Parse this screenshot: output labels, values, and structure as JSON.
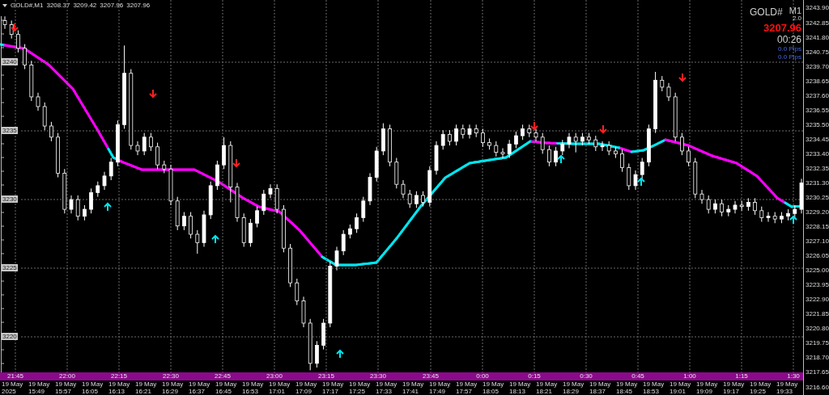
{
  "symbol_bar": {
    "title": "GOLD#,M1",
    "values": [
      "3208.37",
      "3209.42",
      "3207.96",
      "3207.96"
    ]
  },
  "info_panel": {
    "symbol": "GOLD#",
    "timeframe": "M1",
    "version": "2.0",
    "price": "3207.96",
    "countdown": "00:26",
    "pips": [
      "0.0 Pips",
      "0.0 Pips"
    ]
  },
  "level_labels": [
    "3240",
    "3235",
    "3230",
    "3225",
    "3220"
  ],
  "chart": {
    "chart_data": {
      "type": "candlestick",
      "ylim": [
        3216.02,
        3244.48
      ],
      "grid": true,
      "yticks": [
        {
          "value": 3243.9,
          "label": "3243.90"
        },
        {
          "value": 3242.85,
          "label": "3242.85"
        },
        {
          "value": 3241.8,
          "label": "3241.80"
        },
        {
          "value": 3240.75,
          "label": "3240.75"
        },
        {
          "value": 3239.7,
          "label": "3239.70"
        },
        {
          "value": 3238.65,
          "label": "3238.65"
        },
        {
          "value": 3237.6,
          "label": "3237.60"
        },
        {
          "value": 3236.55,
          "label": "3236.55"
        },
        {
          "value": 3235.5,
          "label": "3235.50"
        },
        {
          "value": 3234.45,
          "label": "3234.45"
        },
        {
          "value": 3233.4,
          "label": "3233.40"
        },
        {
          "value": 3232.35,
          "label": "3232.35"
        },
        {
          "value": 3231.3,
          "label": "3231.30"
        },
        {
          "value": 3230.25,
          "label": "3230.25"
        },
        {
          "value": 3229.2,
          "label": "3229.20"
        },
        {
          "value": 3228.15,
          "label": "3228.15"
        },
        {
          "value": 3227.1,
          "label": "3227.10"
        },
        {
          "value": 3226.05,
          "label": "3226.05"
        },
        {
          "value": 3225.0,
          "label": "3225.00"
        },
        {
          "value": 3223.95,
          "label": "3223.95"
        },
        {
          "value": 3222.9,
          "label": "3222.90"
        },
        {
          "value": 3221.85,
          "label": "3221.85"
        },
        {
          "value": 3220.8,
          "label": "3220.80"
        },
        {
          "value": 3219.75,
          "label": "3219.75"
        },
        {
          "value": 3218.7,
          "label": "3218.70"
        },
        {
          "value": 3217.65,
          "label": "3217.65"
        },
        {
          "value": 3216.6,
          "label": "3216.60"
        }
      ],
      "categories": [
        null,
        null,
        null,
        null,
        null,
        null,
        null,
        null,
        null,
        null,
        null,
        null,
        null,
        null,
        null,
        null,
        null,
        null,
        null,
        null,
        null,
        null,
        null,
        null,
        null,
        null,
        null,
        null,
        null,
        null,
        null,
        null,
        null,
        null,
        null,
        null,
        null,
        null,
        null,
        null,
        null,
        null,
        null,
        null,
        null,
        null,
        null,
        null,
        null,
        null,
        null,
        null,
        null,
        null,
        null,
        null,
        null,
        null,
        null,
        null,
        null,
        null,
        null,
        null,
        null,
        null,
        null,
        null,
        null,
        null,
        null,
        null,
        null,
        null,
        null,
        null,
        null,
        null,
        null,
        null,
        null,
        null,
        null,
        null,
        null,
        null,
        null,
        null,
        null,
        null,
        null,
        null,
        null,
        null,
        null,
        null,
        null,
        null,
        null,
        null,
        null,
        null,
        null,
        null,
        null,
        null,
        null,
        null,
        null,
        null,
        null,
        null,
        null,
        null,
        null,
        null,
        null,
        null,
        null,
        null,
        null
      ],
      "ohlc": [
        [
          3243.0,
          3243.3,
          3242.4,
          3242.7
        ],
        [
          3242.7,
          3243.0,
          3241.7,
          3242.0
        ],
        [
          3242.0,
          3242.3,
          3240.7,
          3241.0
        ],
        [
          3241.0,
          3241.3,
          3239.5,
          3239.8
        ],
        [
          3239.8,
          3240.1,
          3237.2,
          3237.5
        ],
        [
          3237.5,
          3237.8,
          3236.5,
          3236.8
        ],
        [
          3236.8,
          3237.1,
          3235.1,
          3235.4
        ],
        [
          3235.4,
          3235.7,
          3234.3,
          3234.6
        ],
        [
          3234.6,
          3234.9,
          3231.7,
          3232.0
        ],
        [
          3232.0,
          3232.3,
          3229.1,
          3229.4
        ],
        [
          3229.4,
          3230.4,
          3229.1,
          3230.1
        ],
        [
          3230.1,
          3230.4,
          3228.6,
          3228.9
        ],
        [
          3228.9,
          3229.7,
          3228.6,
          3229.4
        ],
        [
          3229.4,
          3230.9,
          3229.1,
          3230.6
        ],
        [
          3230.6,
          3231.4,
          3230.3,
          3231.1
        ],
        [
          3231.1,
          3232.1,
          3230.8,
          3231.8
        ],
        [
          3231.8,
          3233.1,
          3231.5,
          3232.8
        ],
        [
          3232.8,
          3235.8,
          3232.5,
          3235.5
        ],
        [
          3235.5,
          3241.2,
          3235.2,
          3239.2
        ],
        [
          3239.2,
          3239.5,
          3233.7,
          3234.0
        ],
        [
          3234.0,
          3234.3,
          3233.3,
          3233.6
        ],
        [
          3233.6,
          3234.9,
          3233.3,
          3234.6
        ],
        [
          3234.6,
          3234.9,
          3233.6,
          3233.9
        ],
        [
          3233.9,
          3234.2,
          3232.3,
          3232.6
        ],
        [
          3232.6,
          3232.9,
          3232.0,
          3232.3
        ],
        [
          3232.3,
          3232.6,
          3229.7,
          3230.0
        ],
        [
          3230.0,
          3230.3,
          3227.9,
          3228.2
        ],
        [
          3228.2,
          3229.2,
          3227.9,
          3228.9
        ],
        [
          3228.9,
          3229.2,
          3227.3,
          3227.6
        ],
        [
          3227.6,
          3227.9,
          3226.2,
          3227.0
        ],
        [
          3227.0,
          3229.3,
          3226.7,
          3229.0
        ],
        [
          3229.0,
          3231.4,
          3228.7,
          3231.1
        ],
        [
          3231.1,
          3232.9,
          3230.8,
          3232.6
        ],
        [
          3232.6,
          3234.6,
          3232.3,
          3234.0
        ],
        [
          3234.0,
          3234.3,
          3229.9,
          3231.0
        ],
        [
          3231.0,
          3231.3,
          3228.5,
          3228.8
        ],
        [
          3228.8,
          3229.1,
          3226.7,
          3227.0
        ],
        [
          3227.0,
          3228.7,
          3226.7,
          3228.4
        ],
        [
          3228.4,
          3229.6,
          3228.1,
          3229.3
        ],
        [
          3229.3,
          3230.8,
          3229.0,
          3230.5
        ],
        [
          3230.5,
          3231.2,
          3230.2,
          3230.9
        ],
        [
          3230.9,
          3231.2,
          3229.1,
          3229.4
        ],
        [
          3229.4,
          3229.7,
          3226.3,
          3226.6
        ],
        [
          3226.6,
          3226.9,
          3223.8,
          3224.1
        ],
        [
          3224.1,
          3224.4,
          3222.5,
          3222.8
        ],
        [
          3222.8,
          3223.1,
          3220.9,
          3221.2
        ],
        [
          3221.2,
          3221.5,
          3217.8,
          3218.3
        ],
        [
          3218.3,
          3219.9,
          3218.0,
          3219.6
        ],
        [
          3219.6,
          3221.5,
          3219.3,
          3221.2
        ],
        [
          3221.2,
          3225.6,
          3220.9,
          3225.3
        ],
        [
          3225.3,
          3226.7,
          3225.0,
          3226.4
        ],
        [
          3226.4,
          3227.9,
          3226.1,
          3227.6
        ],
        [
          3227.6,
          3228.3,
          3227.3,
          3228.0
        ],
        [
          3228.0,
          3229.1,
          3227.7,
          3228.8
        ],
        [
          3228.8,
          3230.3,
          3228.5,
          3230.0
        ],
        [
          3230.0,
          3232.0,
          3229.7,
          3231.7
        ],
        [
          3231.7,
          3233.9,
          3231.4,
          3233.6
        ],
        [
          3233.6,
          3235.6,
          3233.3,
          3235.2
        ],
        [
          3235.2,
          3235.5,
          3232.5,
          3232.8
        ],
        [
          3232.8,
          3233.1,
          3230.9,
          3231.2
        ],
        [
          3231.2,
          3231.5,
          3230.2,
          3230.5
        ],
        [
          3230.5,
          3230.8,
          3229.5,
          3229.8
        ],
        [
          3229.8,
          3230.7,
          3229.5,
          3230.4
        ],
        [
          3230.4,
          3230.7,
          3229.6,
          3229.9
        ],
        [
          3229.9,
          3232.5,
          3229.6,
          3232.2
        ],
        [
          3232.2,
          3234.3,
          3231.9,
          3234.0
        ],
        [
          3234.0,
          3235.1,
          3233.7,
          3234.8
        ],
        [
          3234.8,
          3235.1,
          3234.0,
          3234.3
        ],
        [
          3234.3,
          3235.5,
          3234.0,
          3235.2
        ],
        [
          3235.2,
          3235.5,
          3234.5,
          3234.8
        ],
        [
          3234.8,
          3235.5,
          3234.5,
          3235.2
        ],
        [
          3235.2,
          3235.5,
          3234.6,
          3234.9
        ],
        [
          3234.9,
          3235.2,
          3233.9,
          3234.2
        ],
        [
          3234.2,
          3234.5,
          3233.7,
          3234.0
        ],
        [
          3234.0,
          3234.3,
          3233.2,
          3233.5
        ],
        [
          3233.5,
          3233.8,
          3233.1,
          3233.4
        ],
        [
          3233.4,
          3234.4,
          3233.1,
          3234.1
        ],
        [
          3234.1,
          3235.0,
          3233.8,
          3234.7
        ],
        [
          3234.7,
          3235.5,
          3234.4,
          3235.2
        ],
        [
          3235.2,
          3235.5,
          3234.6,
          3234.9
        ],
        [
          3234.9,
          3235.2,
          3234.3,
          3234.6
        ],
        [
          3234.6,
          3234.9,
          3233.4,
          3233.7
        ],
        [
          3233.7,
          3234.0,
          3232.5,
          3232.8
        ],
        [
          3232.8,
          3233.9,
          3232.5,
          3233.6
        ],
        [
          3233.6,
          3234.4,
          3233.3,
          3234.1
        ],
        [
          3234.1,
          3234.9,
          3233.8,
          3234.6
        ],
        [
          3234.6,
          3234.9,
          3233.5,
          3234.3
        ],
        [
          3234.3,
          3234.9,
          3234.0,
          3234.6
        ],
        [
          3234.6,
          3234.9,
          3234.1,
          3234.4
        ],
        [
          3234.4,
          3234.7,
          3233.6,
          3233.9
        ],
        [
          3233.9,
          3234.3,
          3233.6,
          3234.0
        ],
        [
          3234.0,
          3234.3,
          3233.3,
          3233.6
        ],
        [
          3233.6,
          3233.9,
          3233.1,
          3233.4
        ],
        [
          3233.4,
          3233.7,
          3232.1,
          3232.4
        ],
        [
          3232.4,
          3232.7,
          3230.8,
          3231.1
        ],
        [
          3231.1,
          3232.2,
          3230.8,
          3231.9
        ],
        [
          3231.9,
          3233.1,
          3231.6,
          3232.8
        ],
        [
          3232.8,
          3235.5,
          3232.5,
          3235.2
        ],
        [
          3235.2,
          3239.3,
          3234.9,
          3238.7
        ],
        [
          3238.7,
          3239.0,
          3237.9,
          3238.2
        ],
        [
          3238.2,
          3238.5,
          3237.2,
          3237.5
        ],
        [
          3237.5,
          3237.8,
          3234.3,
          3234.6
        ],
        [
          3234.6,
          3234.9,
          3233.3,
          3233.6
        ],
        [
          3233.6,
          3233.9,
          3232.5,
          3232.8
        ],
        [
          3232.8,
          3233.1,
          3230.2,
          3230.5
        ],
        [
          3230.5,
          3230.8,
          3229.8,
          3230.1
        ],
        [
          3230.1,
          3230.4,
          3229.1,
          3229.4
        ],
        [
          3229.4,
          3230.1,
          3229.1,
          3229.8
        ],
        [
          3229.8,
          3230.1,
          3228.9,
          3229.2
        ],
        [
          3229.2,
          3229.7,
          3228.9,
          3229.4
        ],
        [
          3229.4,
          3230.0,
          3229.1,
          3229.7
        ],
        [
          3229.7,
          3230.0,
          3229.3,
          3229.6
        ],
        [
          3229.6,
          3230.2,
          3229.3,
          3229.9
        ],
        [
          3229.9,
          3230.2,
          3229.0,
          3229.3
        ],
        [
          3229.3,
          3229.6,
          3228.5,
          3228.8
        ],
        [
          3228.8,
          3229.2,
          3228.5,
          3228.9
        ],
        [
          3228.9,
          3229.2,
          3228.4,
          3228.7
        ],
        [
          3228.7,
          3229.2,
          3228.4,
          3228.9
        ],
        [
          3228.9,
          3229.4,
          3228.6,
          3229.1
        ],
        [
          3229.1,
          3229.7,
          3228.8,
          3229.4
        ],
        [
          3229.4,
          3231.6,
          3229.1,
          3231.3
        ]
      ]
    }
  },
  "time_bar": [
    "21:45",
    "22:00",
    "22:15",
    "22:30",
    "22:45",
    "23:00",
    "23:15",
    "23:30",
    "23:45",
    "0:00",
    "0:15",
    "0:30",
    "0:45",
    "1:00",
    "1:15",
    "1:30"
  ],
  "date_axis": [
    "19 May 2025",
    "19 May 15:49",
    "19 May 15:57",
    "19 May 16:05",
    "19 May 16:13",
    "19 May 16:21",
    "19 May 16:29",
    "19 May 16:37",
    "19 May 16:45",
    "19 May 16:53",
    "19 May 17:01",
    "19 May 17:09",
    "19 May 17:17",
    "19 May 17:25",
    "19 May 17:33",
    "19 May 17:41",
    "19 May 17:49",
    "19 May 17:57",
    "19 May 18:05",
    "19 May 18:13",
    "19 May 18:21",
    "19 May 18:29",
    "19 May 18:37",
    "19 May 18:45",
    "19 May 18:53",
    "19 May 19:01",
    "19 May 19:09",
    "19 May 19:17",
    "19 May 19:25",
    "19 May 19:33"
  ]
}
